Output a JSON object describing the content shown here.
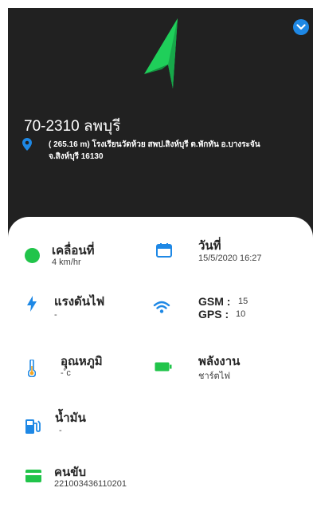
{
  "vehicle": {
    "plate": "70-2310 ลพบุรี",
    "address_line1": "( 265.16 m) โรงเรียนวัดห้วย สพป.สิงห์บุรี ต.พักทัน อ.บางระจัน",
    "address_line2": "จ.สิงห์บุรี 16130"
  },
  "status": {
    "motion_label": "เคลื่อนที่",
    "speed": "4 km/hr",
    "date_label": "วันที่",
    "datetime": "15/5/2020 16:27",
    "voltage_label": "แรงดันไฟ",
    "voltage_value": "-",
    "gsm_label": "GSM :",
    "gsm_value": "15",
    "gps_label": "GPS :",
    "gps_value": "10",
    "temp_label": "อุณหภูมิ",
    "temp_value": "-˚c",
    "power_label": "พลังงาน",
    "power_value": "ชาร์ตไฟ",
    "fuel_label": "น้ำมัน",
    "fuel_value": "-",
    "driver_label": "คนขับ",
    "driver_value": "221003436110201"
  },
  "colors": {
    "header_bg": "#212121",
    "accent_blue": "#1e88e5",
    "moving_green": "#21c44a",
    "logo_green": "#1fcf5a"
  },
  "icons": {
    "expand": "chevron-down-icon",
    "logo": "navigation-arrow-icon",
    "location": "map-pin-icon",
    "status": "status-dot-icon",
    "date": "calendar-icon",
    "voltage": "lightning-icon",
    "signal": "wifi-icon",
    "temperature": "thermometer-icon",
    "battery": "battery-icon",
    "fuel": "fuel-pump-icon",
    "driver": "card-icon"
  }
}
